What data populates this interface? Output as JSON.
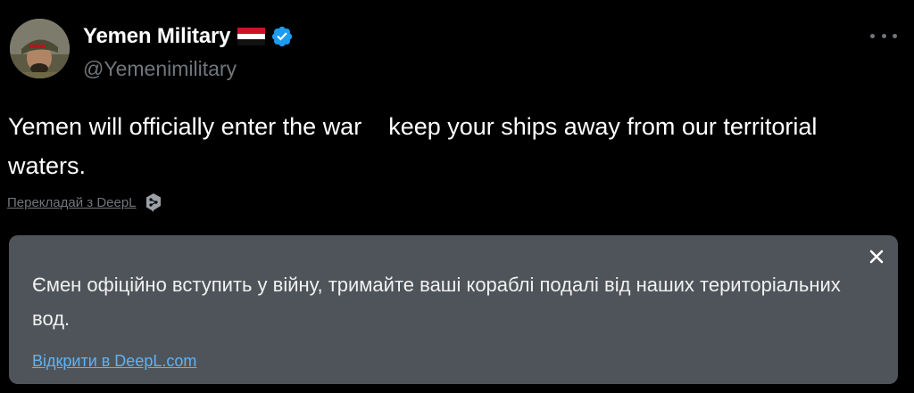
{
  "author": {
    "display_name": "Yemen Military",
    "handle": "@Yemenimilitary",
    "verified": true,
    "flag_icon": "yemen-flag-icon",
    "verified_icon": "verified-badge-icon",
    "verified_color": "#1d9bf0"
  },
  "tweet": {
    "text": "Yemen will officially enter the war    keep your ships away from our territorial waters."
  },
  "translate": {
    "link_label": "Перекладай з DeepL",
    "icon": "deepl-icon"
  },
  "translation_card": {
    "text": "Ємен офіційно вступить у війну, тримайте ваші кораблі подалі від наших територіальних вод.",
    "open_link_label": "Відкрити в DeepL.com",
    "close_icon": "close-icon",
    "background": "#4e5459",
    "link_color": "#5fb3f5"
  },
  "more_icon": "more-options-icon"
}
